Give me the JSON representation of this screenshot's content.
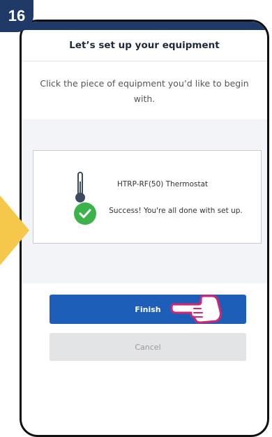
{
  "step": {
    "number": "16"
  },
  "screen": {
    "title": "Let’s set up your equipment",
    "instruction": "Click the piece of equipment you’d like to begin with."
  },
  "device": {
    "name": "HTRP-RF(50) Thermostat",
    "icon": "thermometer-icon",
    "status_icon": "success-check-icon",
    "status_text": "Success! You're all done with set up."
  },
  "actions": {
    "finish_label": "Finish",
    "cancel_label": "Cancel"
  },
  "colors": {
    "badge": "#1f3a66",
    "primary_button": "#1d5fb8",
    "success": "#3bb34a",
    "arrow": "#f5c84c",
    "hand": "#d6246e"
  }
}
